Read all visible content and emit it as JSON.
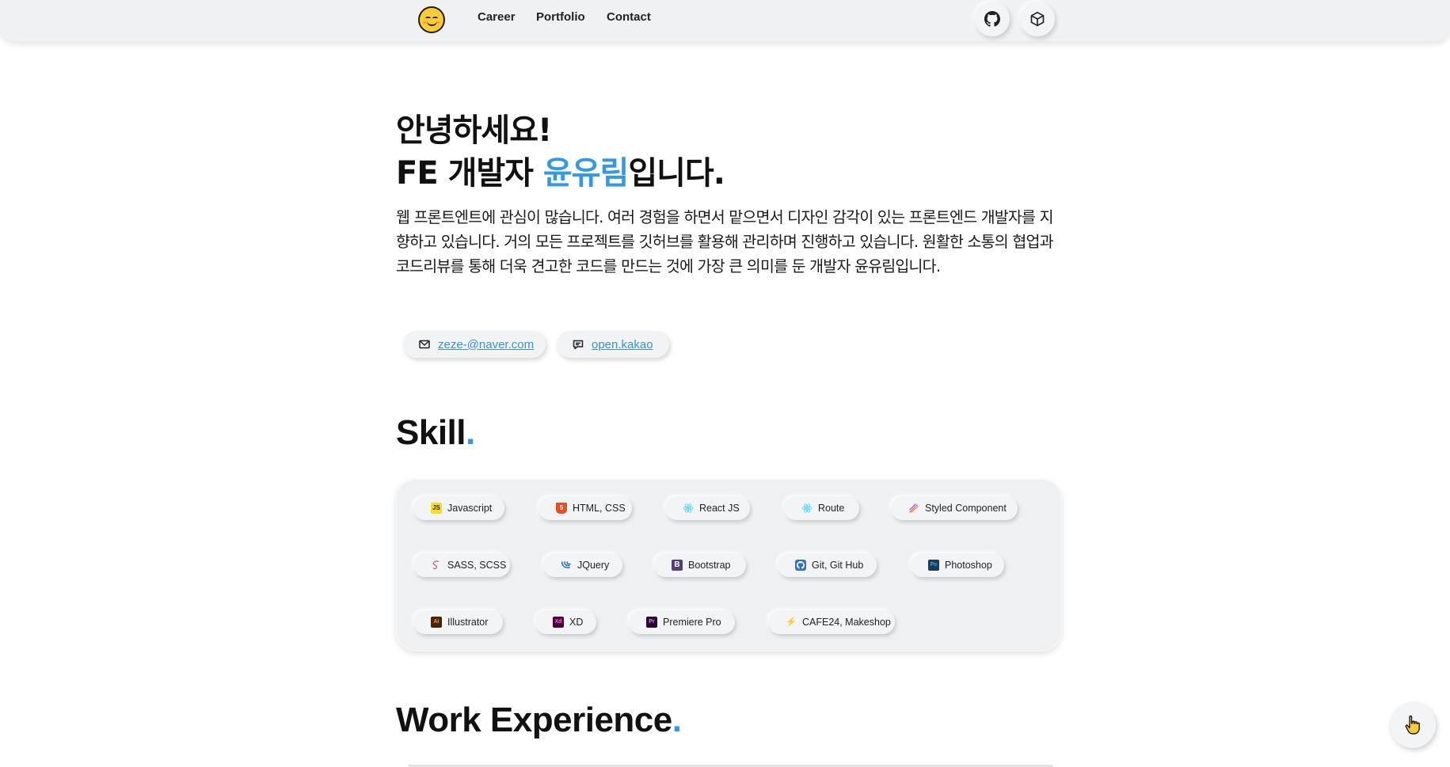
{
  "nav": {
    "items": [
      {
        "label": "Career"
      },
      {
        "label": "Portfolio"
      },
      {
        "label": "Contact"
      }
    ]
  },
  "intro": {
    "greeting": "안녕하세요!",
    "line2_prefix": "FE 개발자 ",
    "name": "윤유림",
    "line2_suffix": "입니다.",
    "description": "웹 프론트엔트에 관심이 많습니다. 여러 경험을 하면서 맡으면서 디자인 감각이 있는 프론트엔드 개발자를 지향하고 있습니다. 거의 모든 프로젝트를 깃허브를 활용해 관리하며 진행하고 있습니다. 원활한 소통의 협업과 코드리뷰를 통해 더욱 견고한 코드를 만드는 것에 가장 큰 의미를 둔 개발자 윤유림입니다."
  },
  "contacts": {
    "email": "zeze-@naver.com",
    "kakao": "open.kakao"
  },
  "sections": {
    "skill": {
      "title": "Skill",
      "dot": "."
    },
    "work": {
      "title": "Work Experience",
      "dot": "."
    }
  },
  "skills": [
    {
      "label": "Javascript",
      "icon": "javascript-icon"
    },
    {
      "label": "HTML, CSS",
      "icon": "html5-icon"
    },
    {
      "label": "React JS",
      "icon": "react-icon"
    },
    {
      "label": "Route",
      "icon": "react-icon"
    },
    {
      "label": "Styled Component",
      "icon": "styled-components-icon"
    },
    {
      "label": "SASS, SCSS",
      "icon": "sass-icon"
    },
    {
      "label": "JQuery",
      "icon": "jquery-icon"
    },
    {
      "label": "Bootstrap",
      "icon": "bootstrap-icon"
    },
    {
      "label": "Git, Git Hub",
      "icon": "github-icon"
    },
    {
      "label": "Photoshop",
      "icon": "photoshop-icon"
    },
    {
      "label": "Illustrator",
      "icon": "illustrator-icon"
    },
    {
      "label": "XD",
      "icon": "xd-icon"
    },
    {
      "label": "Premiere Pro",
      "icon": "premiere-pro-icon"
    },
    {
      "label": "CAFE24, Makeshop",
      "icon": "lightning-icon"
    }
  ],
  "icon_glyphs": {
    "javascript": "JS",
    "html5": "5",
    "bootstrap": "B",
    "photoshop": "Ps",
    "illustrator": "Ai",
    "xd": "Xd",
    "premiere_pro": "Pr",
    "lightning": "⚡"
  },
  "colors": {
    "accent": "#3399e6",
    "link": "#3d8fda",
    "background": "#ffffff",
    "surface": "#f0f1f3"
  }
}
